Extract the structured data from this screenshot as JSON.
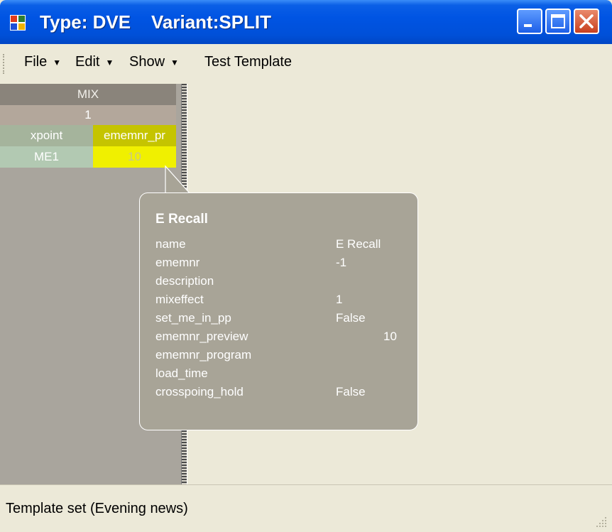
{
  "window": {
    "title_type": "Type: DVE",
    "title_variant": "Variant:SPLIT"
  },
  "menu": {
    "file": "File",
    "edit": "Edit",
    "show": "Show",
    "test_template": "Test Template"
  },
  "grid": {
    "header": "MIX",
    "mix_number": "1",
    "columns": [
      "xpoint",
      "ememnr_pr"
    ],
    "rows": [
      [
        "ME1",
        "10"
      ]
    ]
  },
  "tooltip": {
    "title": "E Recall",
    "fields": [
      {
        "key": "name",
        "value": "E Recall"
      },
      {
        "key": "ememnr",
        "value": "-1"
      },
      {
        "key": "description",
        "value": ""
      },
      {
        "key": "mixeffect",
        "value": "1"
      },
      {
        "key": "set_me_in_pp",
        "value": "False"
      },
      {
        "key": "ememnr_preview",
        "value": "10"
      },
      {
        "key": "ememnr_program",
        "value": ""
      },
      {
        "key": "load_time",
        "value": ""
      },
      {
        "key": "crosspoing_hold",
        "value": "False"
      }
    ]
  },
  "status": {
    "text": "Template set (Evening news)"
  },
  "colors": {
    "titlebar": "#0054e3",
    "grid_header": "#8a847b",
    "highlight_yellow": "#f0f000",
    "tooltip_bg": "#a8a497"
  }
}
